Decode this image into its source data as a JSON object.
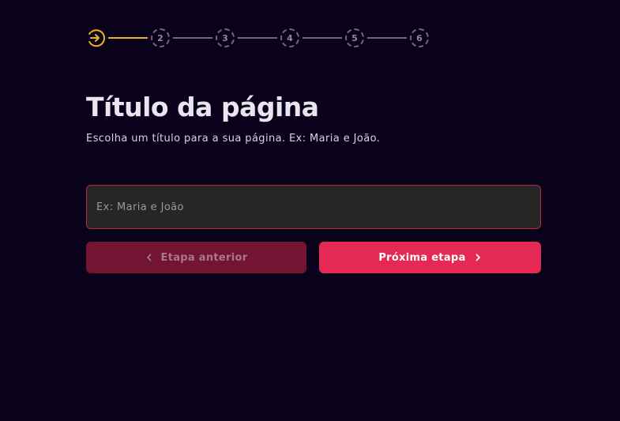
{
  "stepper": {
    "steps": [
      "2",
      "3",
      "4",
      "5",
      "6"
    ],
    "active_color": "#f2b01e",
    "inactive_color": "#6f6a7b"
  },
  "header": {
    "title": "Título da página",
    "subtitle": "Escolha um título para a sua página. Ex: Maria e João."
  },
  "form": {
    "title_input": {
      "value": "",
      "placeholder": "Ex: Maria e João"
    }
  },
  "actions": {
    "prev_label": "Etapa anterior",
    "next_label": "Próxima etapa"
  },
  "colors": {
    "background": "#09021a",
    "accent": "#e42a54",
    "accent_disabled": "#731432",
    "input_border": "#c0283f"
  },
  "icons": {
    "step_current": "arrow-right-circle-icon",
    "prev": "chevron-left-icon",
    "next": "chevron-right-icon"
  }
}
